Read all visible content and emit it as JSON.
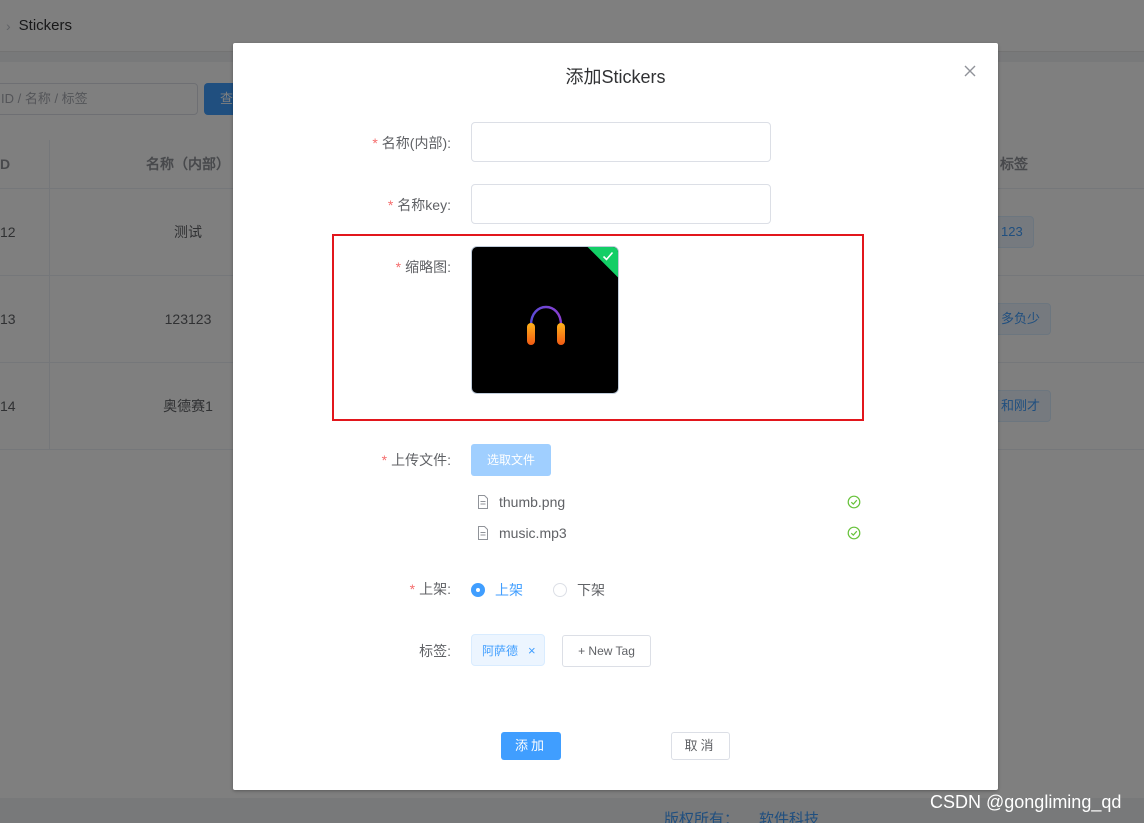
{
  "background": {
    "breadcrumb": {
      "current": "Stickers"
    },
    "search": {
      "placeholder": "ID / 名称 / 标签",
      "button_label": "查"
    },
    "table": {
      "headers": {
        "id": "D",
        "name": "名称（内部）",
        "tags": "标签"
      },
      "rows": [
        {
          "id": "12",
          "name": "测试",
          "tag": "123"
        },
        {
          "id": "13",
          "name": "123123",
          "tag": "多负少"
        },
        {
          "id": "14",
          "name": "奥德赛1",
          "tag": "和刚才"
        }
      ]
    },
    "footer": {
      "left": "版权所有：",
      "right": "软件科技"
    }
  },
  "dialog": {
    "title": "添加Stickers",
    "fields": {
      "name_internal": {
        "label": "名称(内部):",
        "value": ""
      },
      "name_key": {
        "label": "名称key:",
        "value": ""
      },
      "thumbnail": {
        "label": "缩略图:",
        "status": "success"
      },
      "upload": {
        "label": "上传文件:",
        "button_label": "选取文件",
        "files": [
          {
            "name": "thumb.png",
            "status": "success"
          },
          {
            "name": "music.mp3",
            "status": "success"
          }
        ]
      },
      "listing": {
        "label": "上架:",
        "options": [
          {
            "label": "上架",
            "selected": true
          },
          {
            "label": "下架",
            "selected": false
          }
        ]
      },
      "tags": {
        "label": "标签:",
        "items": [
          "阿萨德"
        ],
        "new_tag_label": "+ New Tag"
      }
    },
    "actions": {
      "submit": "添加",
      "cancel": "取消"
    }
  },
  "watermark": "CSDN @gongliming_qd",
  "colors": {
    "primary": "#409eff",
    "required_mark": "#f56c6c",
    "success": "#13ce66",
    "highlight_border": "#e2161c",
    "overlay": "rgba(0,0,0,0.5)"
  },
  "icons": {
    "close": "close-icon",
    "check": "check-icon",
    "document": "document-icon",
    "success": "circle-check-icon",
    "tag_close": "close-icon",
    "thumbnail_art": "headphones-icon"
  }
}
